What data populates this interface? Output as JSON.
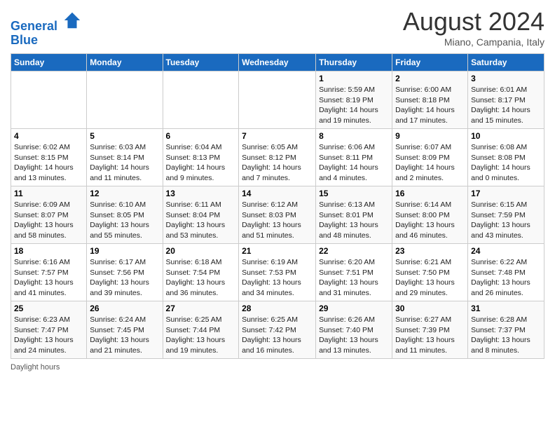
{
  "header": {
    "logo_line1": "General",
    "logo_line2": "Blue",
    "month_year": "August 2024",
    "location": "Miano, Campania, Italy"
  },
  "days_of_week": [
    "Sunday",
    "Monday",
    "Tuesday",
    "Wednesday",
    "Thursday",
    "Friday",
    "Saturday"
  ],
  "weeks": [
    [
      {
        "num": "",
        "info": ""
      },
      {
        "num": "",
        "info": ""
      },
      {
        "num": "",
        "info": ""
      },
      {
        "num": "",
        "info": ""
      },
      {
        "num": "1",
        "info": "Sunrise: 5:59 AM\nSunset: 8:19 PM\nDaylight: 14 hours and 19 minutes."
      },
      {
        "num": "2",
        "info": "Sunrise: 6:00 AM\nSunset: 8:18 PM\nDaylight: 14 hours and 17 minutes."
      },
      {
        "num": "3",
        "info": "Sunrise: 6:01 AM\nSunset: 8:17 PM\nDaylight: 14 hours and 15 minutes."
      }
    ],
    [
      {
        "num": "4",
        "info": "Sunrise: 6:02 AM\nSunset: 8:15 PM\nDaylight: 14 hours and 13 minutes."
      },
      {
        "num": "5",
        "info": "Sunrise: 6:03 AM\nSunset: 8:14 PM\nDaylight: 14 hours and 11 minutes."
      },
      {
        "num": "6",
        "info": "Sunrise: 6:04 AM\nSunset: 8:13 PM\nDaylight: 14 hours and 9 minutes."
      },
      {
        "num": "7",
        "info": "Sunrise: 6:05 AM\nSunset: 8:12 PM\nDaylight: 14 hours and 7 minutes."
      },
      {
        "num": "8",
        "info": "Sunrise: 6:06 AM\nSunset: 8:11 PM\nDaylight: 14 hours and 4 minutes."
      },
      {
        "num": "9",
        "info": "Sunrise: 6:07 AM\nSunset: 8:09 PM\nDaylight: 14 hours and 2 minutes."
      },
      {
        "num": "10",
        "info": "Sunrise: 6:08 AM\nSunset: 8:08 PM\nDaylight: 14 hours and 0 minutes."
      }
    ],
    [
      {
        "num": "11",
        "info": "Sunrise: 6:09 AM\nSunset: 8:07 PM\nDaylight: 13 hours and 58 minutes."
      },
      {
        "num": "12",
        "info": "Sunrise: 6:10 AM\nSunset: 8:05 PM\nDaylight: 13 hours and 55 minutes."
      },
      {
        "num": "13",
        "info": "Sunrise: 6:11 AM\nSunset: 8:04 PM\nDaylight: 13 hours and 53 minutes."
      },
      {
        "num": "14",
        "info": "Sunrise: 6:12 AM\nSunset: 8:03 PM\nDaylight: 13 hours and 51 minutes."
      },
      {
        "num": "15",
        "info": "Sunrise: 6:13 AM\nSunset: 8:01 PM\nDaylight: 13 hours and 48 minutes."
      },
      {
        "num": "16",
        "info": "Sunrise: 6:14 AM\nSunset: 8:00 PM\nDaylight: 13 hours and 46 minutes."
      },
      {
        "num": "17",
        "info": "Sunrise: 6:15 AM\nSunset: 7:59 PM\nDaylight: 13 hours and 43 minutes."
      }
    ],
    [
      {
        "num": "18",
        "info": "Sunrise: 6:16 AM\nSunset: 7:57 PM\nDaylight: 13 hours and 41 minutes."
      },
      {
        "num": "19",
        "info": "Sunrise: 6:17 AM\nSunset: 7:56 PM\nDaylight: 13 hours and 39 minutes."
      },
      {
        "num": "20",
        "info": "Sunrise: 6:18 AM\nSunset: 7:54 PM\nDaylight: 13 hours and 36 minutes."
      },
      {
        "num": "21",
        "info": "Sunrise: 6:19 AM\nSunset: 7:53 PM\nDaylight: 13 hours and 34 minutes."
      },
      {
        "num": "22",
        "info": "Sunrise: 6:20 AM\nSunset: 7:51 PM\nDaylight: 13 hours and 31 minutes."
      },
      {
        "num": "23",
        "info": "Sunrise: 6:21 AM\nSunset: 7:50 PM\nDaylight: 13 hours and 29 minutes."
      },
      {
        "num": "24",
        "info": "Sunrise: 6:22 AM\nSunset: 7:48 PM\nDaylight: 13 hours and 26 minutes."
      }
    ],
    [
      {
        "num": "25",
        "info": "Sunrise: 6:23 AM\nSunset: 7:47 PM\nDaylight: 13 hours and 24 minutes."
      },
      {
        "num": "26",
        "info": "Sunrise: 6:24 AM\nSunset: 7:45 PM\nDaylight: 13 hours and 21 minutes."
      },
      {
        "num": "27",
        "info": "Sunrise: 6:25 AM\nSunset: 7:44 PM\nDaylight: 13 hours and 19 minutes."
      },
      {
        "num": "28",
        "info": "Sunrise: 6:25 AM\nSunset: 7:42 PM\nDaylight: 13 hours and 16 minutes."
      },
      {
        "num": "29",
        "info": "Sunrise: 6:26 AM\nSunset: 7:40 PM\nDaylight: 13 hours and 13 minutes."
      },
      {
        "num": "30",
        "info": "Sunrise: 6:27 AM\nSunset: 7:39 PM\nDaylight: 13 hours and 11 minutes."
      },
      {
        "num": "31",
        "info": "Sunrise: 6:28 AM\nSunset: 7:37 PM\nDaylight: 13 hours and 8 minutes."
      }
    ]
  ],
  "footer": {
    "note": "Daylight hours"
  }
}
